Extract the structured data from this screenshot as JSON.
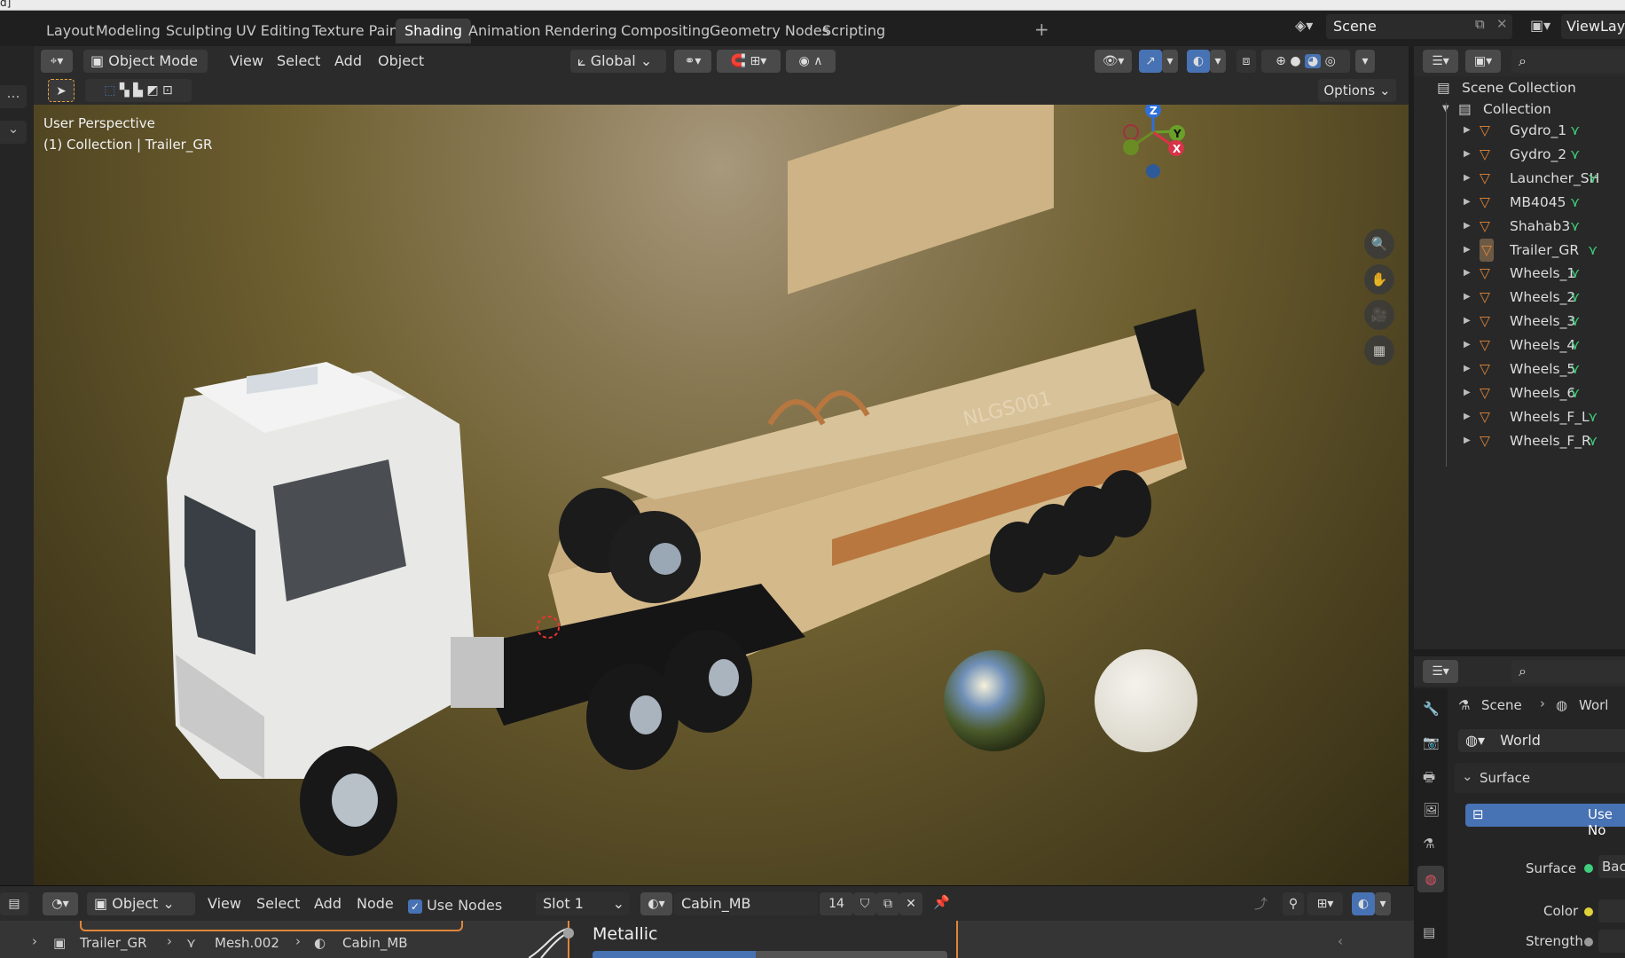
{
  "window_strip": {
    "fragment": "d]"
  },
  "tabs": {
    "items": [
      {
        "label": "Layout"
      },
      {
        "label": "Modeling"
      },
      {
        "label": "Sculpting"
      },
      {
        "label": "UV Editing"
      },
      {
        "label": "Texture Paint"
      },
      {
        "label": "Shading"
      },
      {
        "label": "Animation"
      },
      {
        "label": "Rendering"
      },
      {
        "label": "Compositing"
      },
      {
        "label": "Geometry Nodes"
      },
      {
        "label": "Scripting"
      }
    ],
    "active": "Shading",
    "plus": "+"
  },
  "scene": {
    "name": "Scene",
    "view_layer": "ViewLay"
  },
  "viewport_header": {
    "mode": "Object Mode",
    "view": "View",
    "select": "Select",
    "add": "Add",
    "object": "Object",
    "transform_orientation": "Global",
    "options": "Options"
  },
  "viewport": {
    "perspective": "User Perspective",
    "context": "(1) Collection | Trailer_GR",
    "gizmo_axes": {
      "z": "Z",
      "y": "Y",
      "x": "X"
    },
    "missile_text": "NLGS001"
  },
  "outliner": {
    "root": "Scene Collection",
    "collection": "Collection",
    "objects": [
      {
        "name": "Gydro_1"
      },
      {
        "name": "Gydro_2"
      },
      {
        "name": "Launcher_SH"
      },
      {
        "name": "MB4045"
      },
      {
        "name": "Shahab3"
      },
      {
        "name": "Trailer_GR",
        "selected": true
      },
      {
        "name": "Wheels_1"
      },
      {
        "name": "Wheels_2"
      },
      {
        "name": "Wheels_3"
      },
      {
        "name": "Wheels_4"
      },
      {
        "name": "Wheels_5"
      },
      {
        "name": "Wheels_6"
      },
      {
        "name": "Wheels_F_L"
      },
      {
        "name": "Wheels_F_R"
      }
    ]
  },
  "properties": {
    "breadcrumb_scene": "Scene",
    "breadcrumb_world": "Worl",
    "world_name": "World",
    "panel": "Surface",
    "use_nodes": "Use No",
    "surface_label": "Surface",
    "surface_value": "Back",
    "color_label": "Color",
    "strength_label": "Strength"
  },
  "node_editor": {
    "type": "Object",
    "view": "View",
    "select": "Select",
    "add": "Add",
    "node": "Node",
    "use_nodes": "Use Nodes",
    "slot": "Slot 1",
    "material": "Cabin_MB",
    "users": "14",
    "breadcrumb": [
      "Trailer_GR",
      "Mesh.002",
      "Cabin_MB"
    ],
    "socket_label": "Metallic"
  },
  "colors": {
    "accent": "#4772b3",
    "selection": "#e8a33b",
    "object_icon": "#e0863a",
    "mesh_icon": "#3fcf7c"
  }
}
